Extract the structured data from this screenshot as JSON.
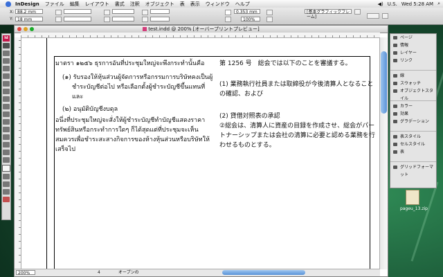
{
  "menubar": {
    "app": "InDesign",
    "items": [
      "ファイル",
      "編集",
      "レイアウト",
      "書式",
      "注釈",
      "オブジェクト",
      "表",
      "表示",
      "ウィンドウ",
      "ヘルプ"
    ],
    "locale": "U.S.",
    "clock": "Wed 5:28 AM"
  },
  "control": {
    "x_label": "X:",
    "x_value": "88.2 mm",
    "y_label": "Y:",
    "y_value": "18 mm",
    "stroke_value": "0.353 mm",
    "percent_value": "100%",
    "style_value": "[基本グラフィックフレーム]"
  },
  "document": {
    "title": "test.indd @ 200% [オーバープリントプレビュー]",
    "zoom": "200%",
    "page_number": "4",
    "preview_label": "オープンの"
  },
  "content": {
    "thai": {
      "heading": "มาตรา ๑๒๕๖  ธุรการอันที่ประชุมใหญ่จะพึงกระทำนั้นคือ",
      "item1": "(๑)  รับรองให้หุ้นส่วนผู้จัดการหรือกรรมการบริษัทคงเป็นผู้ชำระบัญชีต่อไป  หรือเลือกตั้งผู้ชำระบัญชีขึ้นแทนที่ และ",
      "item2": "(๒)  อนุมัติบัญชีงบดุล",
      "item2_body": "อนึ่งที่ประชุมใหญ่จะสั่งให้ผู้ชำระบัญชีทำบัญชีแสดงราคาทรัพย์สินหรือกระทำการใดๆ  ก็ได้สุดแต่ที่ประชุมจะเห็นสมควรเพื่อชำระสะสางกิจการของห้างหุ้นส่วนหรือบริษัทให้เสร็จไป"
    },
    "japanese": {
      "heading": "第 1256 号　総会では以下のことを審議する。",
      "item1": "(1) 業務執行社員または取締役が今後清算人となることの確認、および",
      "item2": "(2) 貸借対照表の承認",
      "item2_body": "②総会は、清算人に資産の目録を作成させ、総会がパートナーシップまたは会社の清算に必要と認める業務を行わせるものとする。"
    }
  },
  "panel": {
    "groups": [
      [
        "ページ",
        "情報",
        "レイヤー",
        "リンク"
      ],
      [
        "線",
        "スウォッチ",
        "オブジェクトスタイル"
      ],
      [
        "カラー",
        "効果",
        "グラデーション"
      ],
      [
        "表スタイル",
        "セルスタイル",
        "表"
      ],
      [
        "グリッドフォーマット"
      ]
    ]
  },
  "desktop": {
    "file_name": "pageu_13.zip"
  }
}
